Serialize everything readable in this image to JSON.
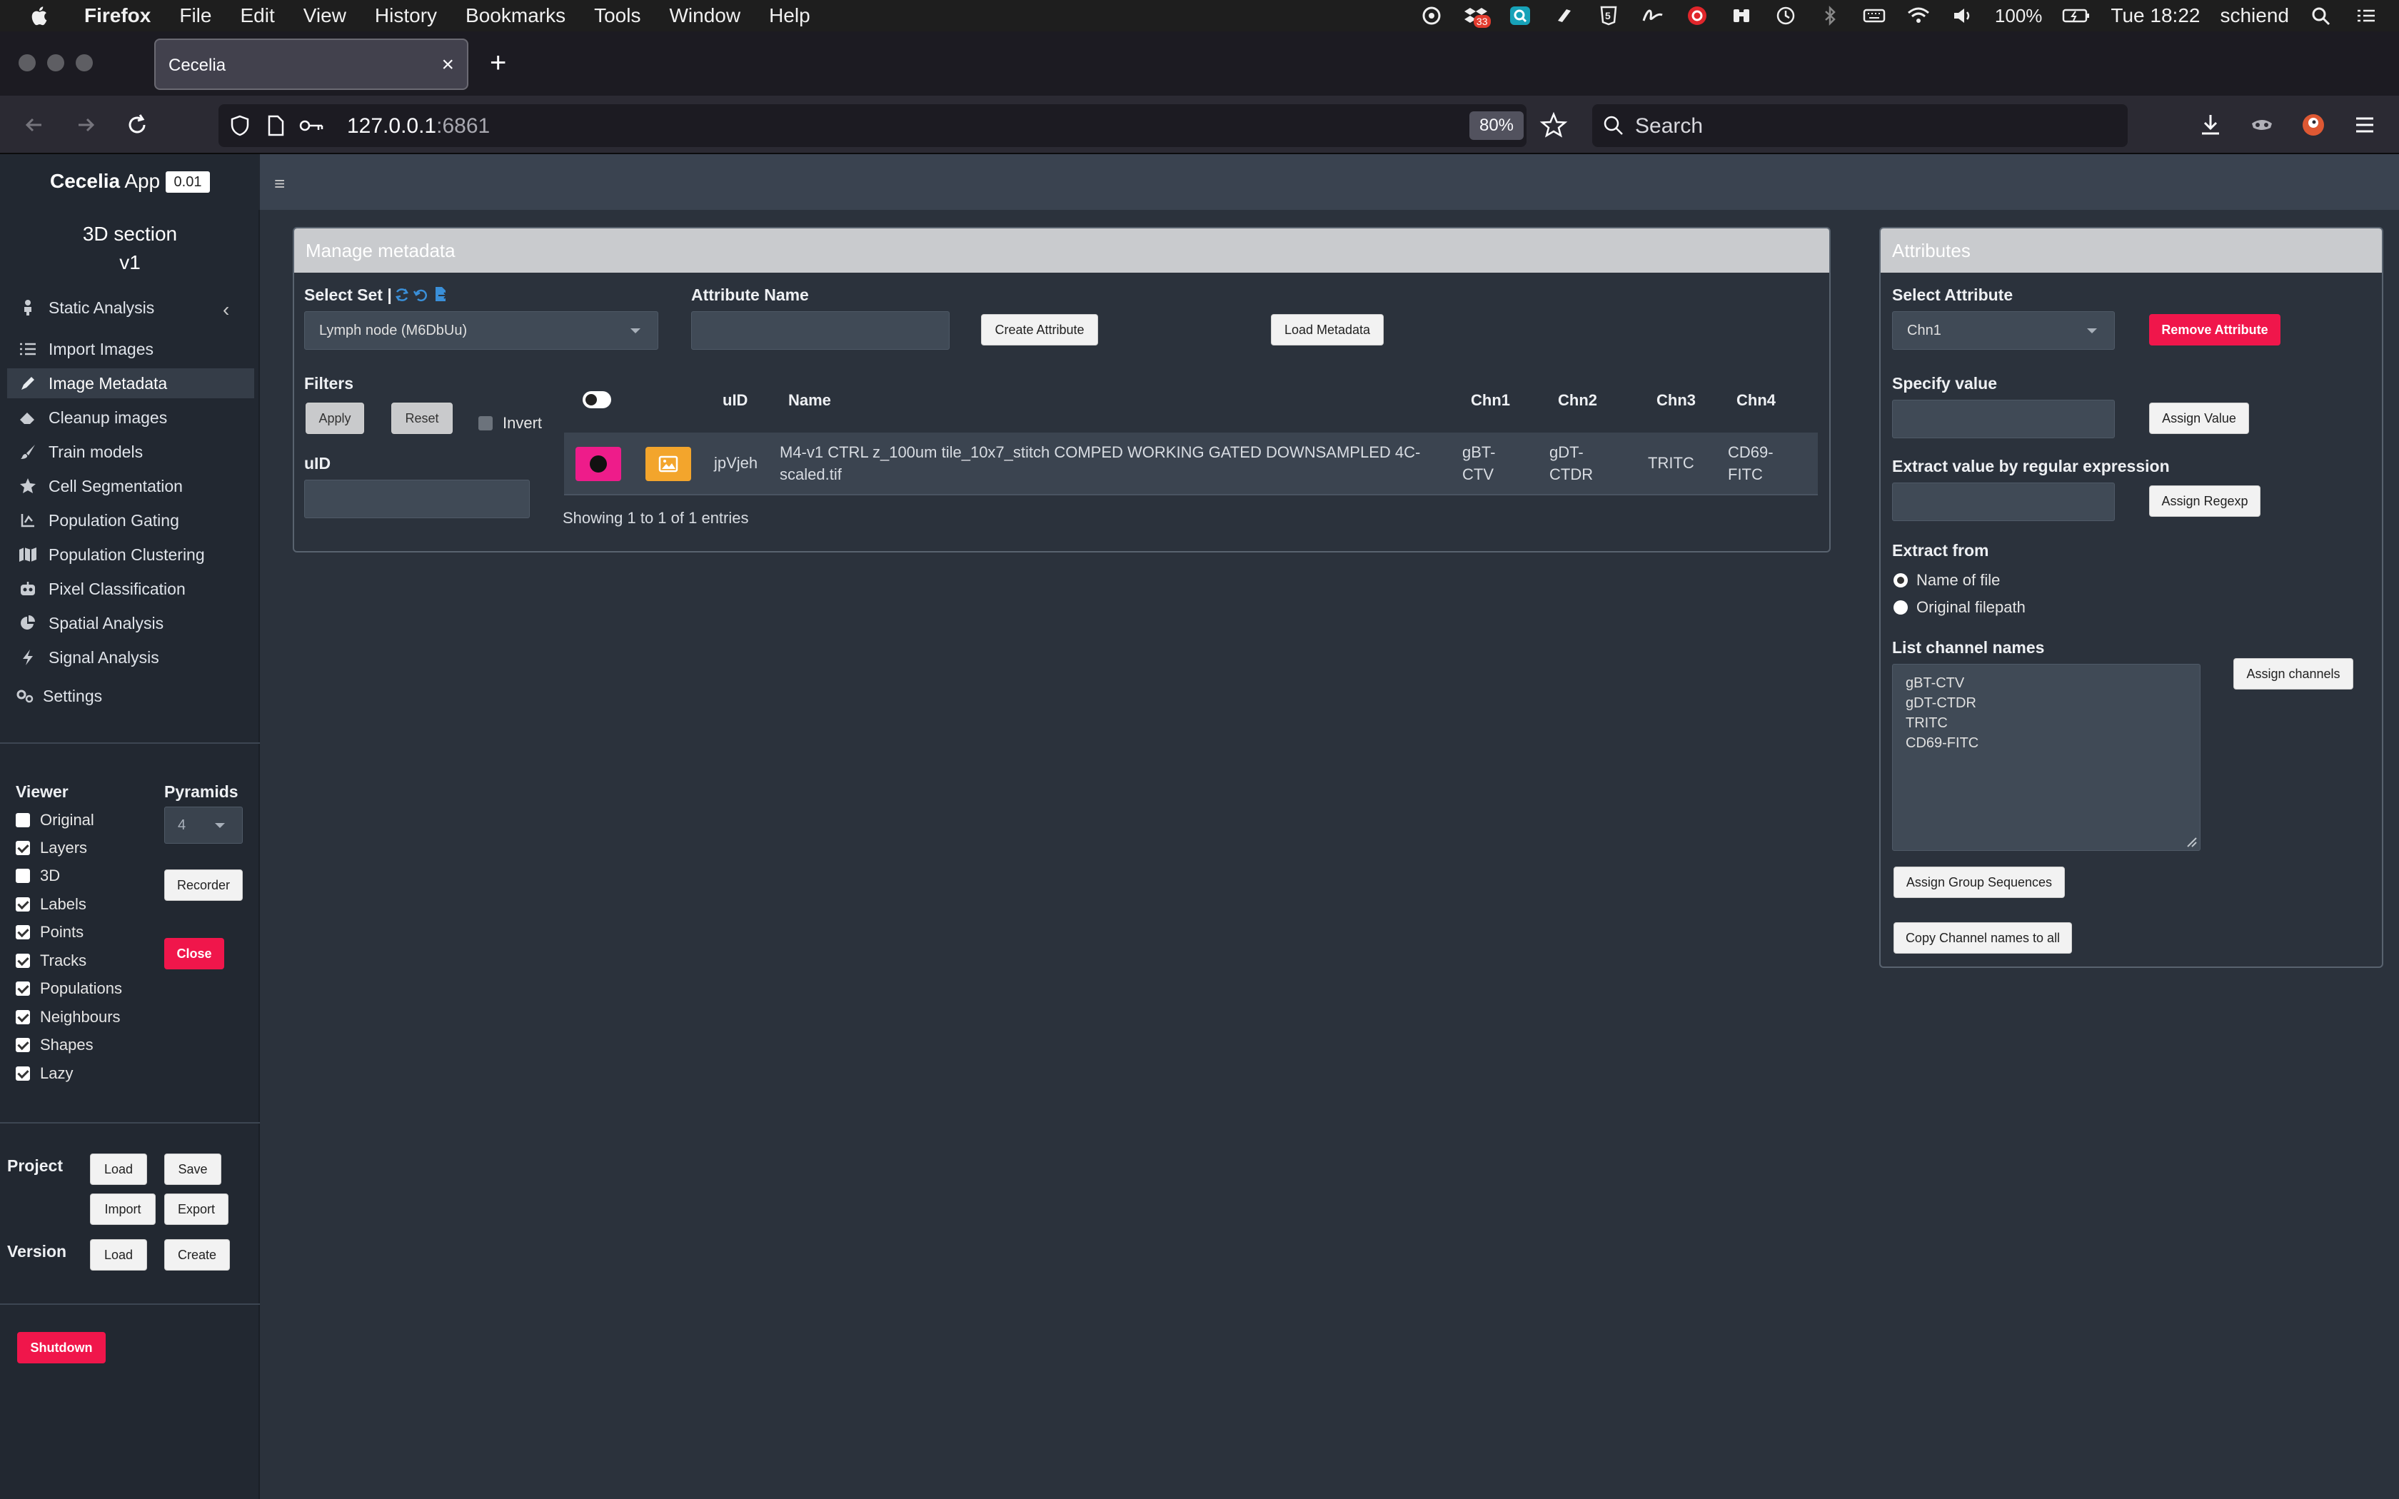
{
  "menubar": {
    "app": "Firefox",
    "items": [
      "File",
      "Edit",
      "View",
      "History",
      "Bookmarks",
      "Tools",
      "Window",
      "Help"
    ],
    "battery": "100%",
    "clock": "Tue 18:22",
    "user": "schiend",
    "dropbox_badge": "33"
  },
  "browser": {
    "tab_title": "Cecelia",
    "url_host": "127.0.0.1",
    "url_port": ":6861",
    "zoom": "80%",
    "search_placeholder": "Search"
  },
  "app": {
    "title": "Cecelia",
    "title_suffix": "App",
    "version": "0.01"
  },
  "sidebar": {
    "section_line1": "3D section",
    "section_line2": "v1",
    "group": "Static Analysis",
    "items": [
      {
        "label": "Import Images",
        "icon": "list-icon"
      },
      {
        "label": "Image Metadata",
        "icon": "pen-icon"
      },
      {
        "label": "Cleanup images",
        "icon": "eraser-icon"
      },
      {
        "label": "Train models",
        "icon": "brush-icon"
      },
      {
        "label": "Cell Segmentation",
        "icon": "cog-star-icon"
      },
      {
        "label": "Population Gating",
        "icon": "gating-icon"
      },
      {
        "label": "Population Clustering",
        "icon": "map-icon"
      },
      {
        "label": "Pixel Classification",
        "icon": "robot-icon"
      },
      {
        "label": "Spatial Analysis",
        "icon": "pie-icon"
      },
      {
        "label": "Signal Analysis",
        "icon": "bolt-icon"
      }
    ],
    "settings": "Settings",
    "viewer": {
      "label": "Viewer",
      "options": [
        {
          "label": "Original",
          "checked": false
        },
        {
          "label": "Layers",
          "checked": true
        },
        {
          "label": "3D",
          "checked": false
        },
        {
          "label": "Labels",
          "checked": true
        },
        {
          "label": "Points",
          "checked": true
        },
        {
          "label": "Tracks",
          "checked": true
        },
        {
          "label": "Populations",
          "checked": true
        },
        {
          "label": "Neighbours",
          "checked": true
        },
        {
          "label": "Shapes",
          "checked": true
        },
        {
          "label": "Lazy",
          "checked": true
        }
      ],
      "pyramids_label": "Pyramids",
      "pyramids_value": "4",
      "recorder": "Recorder",
      "close": "Close"
    },
    "project": {
      "label": "Project",
      "load": "Load",
      "save": "Save",
      "import": "Import",
      "export": "Export"
    },
    "version": {
      "label": "Version",
      "load": "Load",
      "create": "Create"
    },
    "shutdown": "Shutdown"
  },
  "manage": {
    "title": "Manage metadata",
    "select_set_label": "Select Set |",
    "select_set_value": "Lymph node (M6DbUu)",
    "attr_name_label": "Attribute Name",
    "create_attribute": "Create Attribute",
    "load_metadata": "Load Metadata",
    "filters_label": "Filters",
    "apply": "Apply",
    "reset": "Reset",
    "invert": "Invert",
    "uid_label": "uID",
    "table": {
      "headers": [
        "uID",
        "Name",
        "Chn1",
        "Chn2",
        "Chn3",
        "Chn4"
      ],
      "rows": [
        {
          "uid": "jpVjeh",
          "name_line1": "M4-v1 CTRL z_100um tile_10x7_stitch COMPED WORKING GATED DOWNSAMPLED 4C-",
          "name_line2": "scaled.tif",
          "chn1_line1": "gBT-",
          "chn1_line2": "CTV",
          "chn2_line1": "gDT-",
          "chn2_line2": "CTDR",
          "chn3": "TRITC",
          "chn4_line1": "CD69-",
          "chn4_line2": "FITC"
        }
      ],
      "footer": "Showing 1 to 1 of 1 entries"
    }
  },
  "attributes": {
    "title": "Attributes",
    "select_attr_label": "Select Attribute",
    "select_attr_value": "Chn1",
    "remove_attribute": "Remove Attribute",
    "specify_value_label": "Specify value",
    "assign_value": "Assign Value",
    "regex_label": "Extract value by regular expression",
    "assign_regexp": "Assign Regexp",
    "extract_from_label": "Extract from",
    "extract_options": [
      {
        "label": "Name of file",
        "selected": true
      },
      {
        "label": "Original filepath",
        "selected": false
      }
    ],
    "channel_names_label": "List channel names",
    "channel_names_text": "gBT-CTV\ngDT-CTDR\nTRITC\nCD69-FITC",
    "assign_channels": "Assign channels",
    "assign_group_sequences": "Assign Group Sequences",
    "copy_channel_names": "Copy Channel names to all"
  },
  "colors": {
    "accent_red": "#f0164b",
    "row_pink": "#ee1c8a",
    "row_orange": "#f3a52c",
    "link_blue": "#3a8fd8"
  }
}
